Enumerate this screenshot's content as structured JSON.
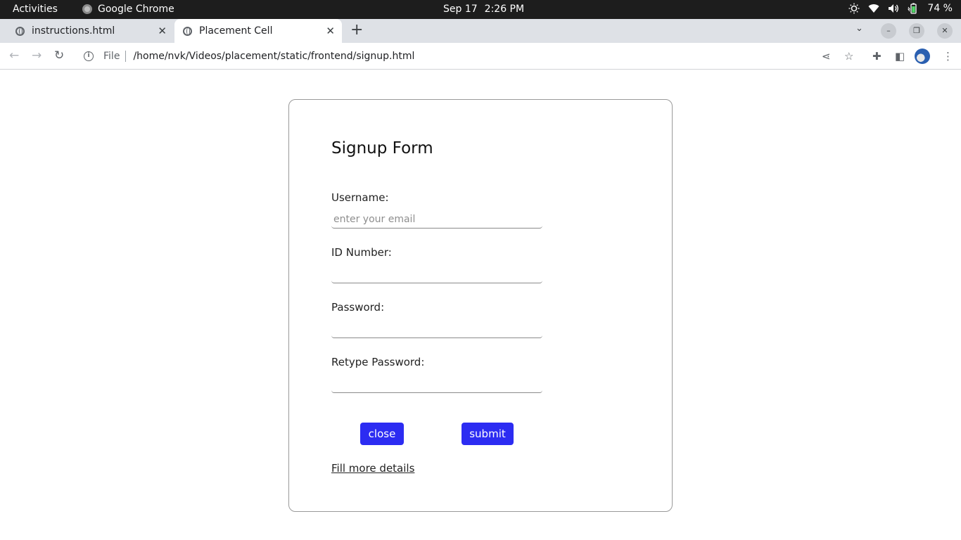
{
  "system_bar": {
    "activities": "Activities",
    "app_name": "Google Chrome",
    "date": "Sep 17",
    "time": "2:26 PM",
    "battery": "74 %"
  },
  "tabs": [
    {
      "title": "instructions.html",
      "active": false
    },
    {
      "title": "Placement Cell",
      "active": true
    }
  ],
  "address_bar": {
    "scheme_label": "File",
    "url": "/home/nvk/Videos/placement/static/frontend/signup.html"
  },
  "form": {
    "title": "Signup Form",
    "fields": [
      {
        "label": "Username:",
        "placeholder": "enter your email",
        "value": ""
      },
      {
        "label": "ID Number:",
        "placeholder": "",
        "value": ""
      },
      {
        "label": "Password:",
        "placeholder": "",
        "value": ""
      },
      {
        "label": "Retype Password:",
        "placeholder": "",
        "value": ""
      }
    ],
    "close_label": "close",
    "submit_label": "submit",
    "more_link": "Fill more details"
  },
  "colors": {
    "button_bg": "#2c2cf2",
    "topbar_bg": "#1d1d1d",
    "tabstrip_bg": "#dee1e6"
  }
}
